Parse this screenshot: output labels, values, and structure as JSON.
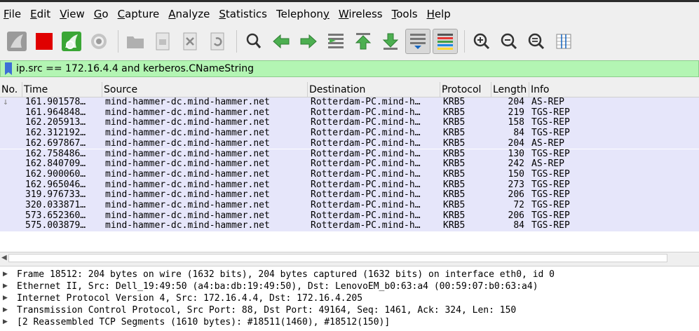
{
  "menu": [
    {
      "pre": "",
      "mn": "F",
      "post": "ile"
    },
    {
      "pre": "",
      "mn": "E",
      "post": "dit"
    },
    {
      "pre": "",
      "mn": "V",
      "post": "iew"
    },
    {
      "pre": "",
      "mn": "G",
      "post": "o"
    },
    {
      "pre": "",
      "mn": "C",
      "post": "apture"
    },
    {
      "pre": "",
      "mn": "A",
      "post": "nalyze"
    },
    {
      "pre": "",
      "mn": "S",
      "post": "tatistics"
    },
    {
      "pre": "Telephon",
      "mn": "y",
      "post": ""
    },
    {
      "pre": "",
      "mn": "W",
      "post": "ireless"
    },
    {
      "pre": "",
      "mn": "T",
      "post": "ools"
    },
    {
      "pre": "",
      "mn": "H",
      "post": "elp"
    }
  ],
  "toolbar_icons": [
    "shark-fin-start-icon",
    "stop-capture-icon",
    "restart-capture-icon",
    "capture-options-icon",
    "open-file-icon",
    "save-file-icon",
    "close-file-icon",
    "reload-file-icon",
    "find-packet-icon",
    "go-back-icon",
    "go-forward-icon",
    "go-to-packet-icon",
    "first-packet-icon",
    "last-packet-icon",
    "autoscroll-icon",
    "colorize-icon",
    "zoom-in-icon",
    "zoom-out-icon",
    "normal-size-icon",
    "resize-columns-icon"
  ],
  "filter": {
    "value": "ip.src == 172.16.4.4 and kerberos.CNameString"
  },
  "columns": {
    "no": "No.",
    "time": "Time",
    "source": "Source",
    "destination": "Destination",
    "protocol": "Protocol",
    "length": "Length",
    "info": "Info"
  },
  "packets": [
    {
      "time": "161.901578…",
      "source": "mind-hammer-dc.mind-hammer.net",
      "destination": "Rotterdam-PC.mind-h…",
      "protocol": "KRB5",
      "length": "204",
      "info": "AS-REP"
    },
    {
      "time": "161.964848…",
      "source": "mind-hammer-dc.mind-hammer.net",
      "destination": "Rotterdam-PC.mind-h…",
      "protocol": "KRB5",
      "length": "219",
      "info": "TGS-REP"
    },
    {
      "time": "162.205913…",
      "source": "mind-hammer-dc.mind-hammer.net",
      "destination": "Rotterdam-PC.mind-h…",
      "protocol": "KRB5",
      "length": "158",
      "info": "TGS-REP"
    },
    {
      "time": "162.312192…",
      "source": "mind-hammer-dc.mind-hammer.net",
      "destination": "Rotterdam-PC.mind-h…",
      "protocol": "KRB5",
      "length": "84",
      "info": "TGS-REP"
    },
    {
      "time": "162.697867…",
      "source": "mind-hammer-dc.mind-hammer.net",
      "destination": "Rotterdam-PC.mind-h…",
      "protocol": "KRB5",
      "length": "204",
      "info": "AS-REP"
    },
    {
      "time": "162.758486…",
      "source": "mind-hammer-dc.mind-hammer.net",
      "destination": "Rotterdam-PC.mind-h…",
      "protocol": "KRB5",
      "length": "130",
      "info": "TGS-REP"
    },
    {
      "time": "162.840709…",
      "source": "mind-hammer-dc.mind-hammer.net",
      "destination": "Rotterdam-PC.mind-h…",
      "protocol": "KRB5",
      "length": "242",
      "info": "AS-REP"
    },
    {
      "time": "162.900060…",
      "source": "mind-hammer-dc.mind-hammer.net",
      "destination": "Rotterdam-PC.mind-h…",
      "protocol": "KRB5",
      "length": "150",
      "info": "TGS-REP"
    },
    {
      "time": "162.965046…",
      "source": "mind-hammer-dc.mind-hammer.net",
      "destination": "Rotterdam-PC.mind-h…",
      "protocol": "KRB5",
      "length": "273",
      "info": "TGS-REP"
    },
    {
      "time": "319.976733…",
      "source": "mind-hammer-dc.mind-hammer.net",
      "destination": "Rotterdam-PC.mind-h…",
      "protocol": "KRB5",
      "length": "206",
      "info": "TGS-REP"
    },
    {
      "time": "320.033871…",
      "source": "mind-hammer-dc.mind-hammer.net",
      "destination": "Rotterdam-PC.mind-h…",
      "protocol": "KRB5",
      "length": "72",
      "info": "TGS-REP"
    },
    {
      "time": "573.652360…",
      "source": "mind-hammer-dc.mind-hammer.net",
      "destination": "Rotterdam-PC.mind-h…",
      "protocol": "KRB5",
      "length": "206",
      "info": "TGS-REP"
    },
    {
      "time": "575.003879…",
      "source": "mind-hammer-dc.mind-hammer.net",
      "destination": "Rotterdam-PC.mind-h…",
      "protocol": "KRB5",
      "length": "84",
      "info": "TGS-REP"
    }
  ],
  "details": [
    "Frame 18512: 204 bytes on wire (1632 bits), 204 bytes captured (1632 bits) on interface eth0, id 0",
    "Ethernet II, Src: Dell_19:49:50 (a4:ba:db:19:49:50), Dst: LenovoEM_b0:63:a4 (00:59:07:b0:63:a4)",
    "Internet Protocol Version 4, Src: 172.16.4.4, Dst: 172.16.4.205",
    "Transmission Control Protocol, Src Port: 88, Dst Port: 49164, Seq: 1461, Ack: 324, Len: 150",
    "[2 Reassembled TCP Segments (1610 bytes): #18511(1460), #18512(150)]"
  ],
  "colors": {
    "filter_ok": "#b3f5b3",
    "row_bg": "#e6e6fa",
    "stop_red": "#e00000"
  }
}
